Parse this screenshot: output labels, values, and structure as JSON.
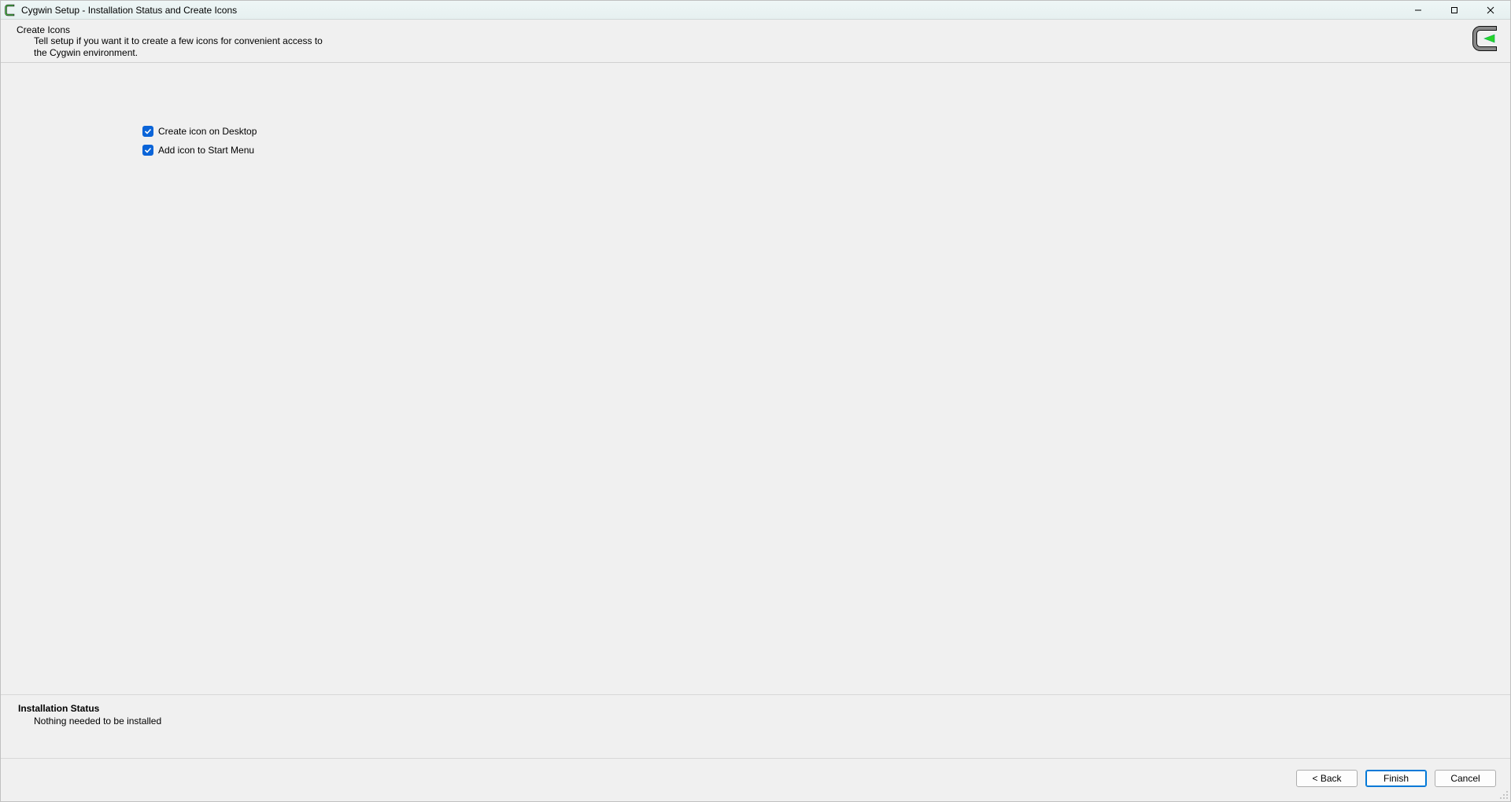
{
  "window": {
    "title": "Cygwin Setup - Installation Status and Create Icons"
  },
  "header": {
    "title": "Create Icons",
    "subtitle": "Tell setup if you want it to create a few icons for convenient access to the Cygwin environment."
  },
  "options": {
    "desktop": {
      "label": "Create icon on Desktop",
      "checked": true
    },
    "startmenu": {
      "label": "Add icon to Start Menu",
      "checked": true
    }
  },
  "status": {
    "title": "Installation Status",
    "message": "Nothing needed to be installed"
  },
  "buttons": {
    "back": "< Back",
    "finish": "Finish",
    "cancel": "Cancel"
  }
}
